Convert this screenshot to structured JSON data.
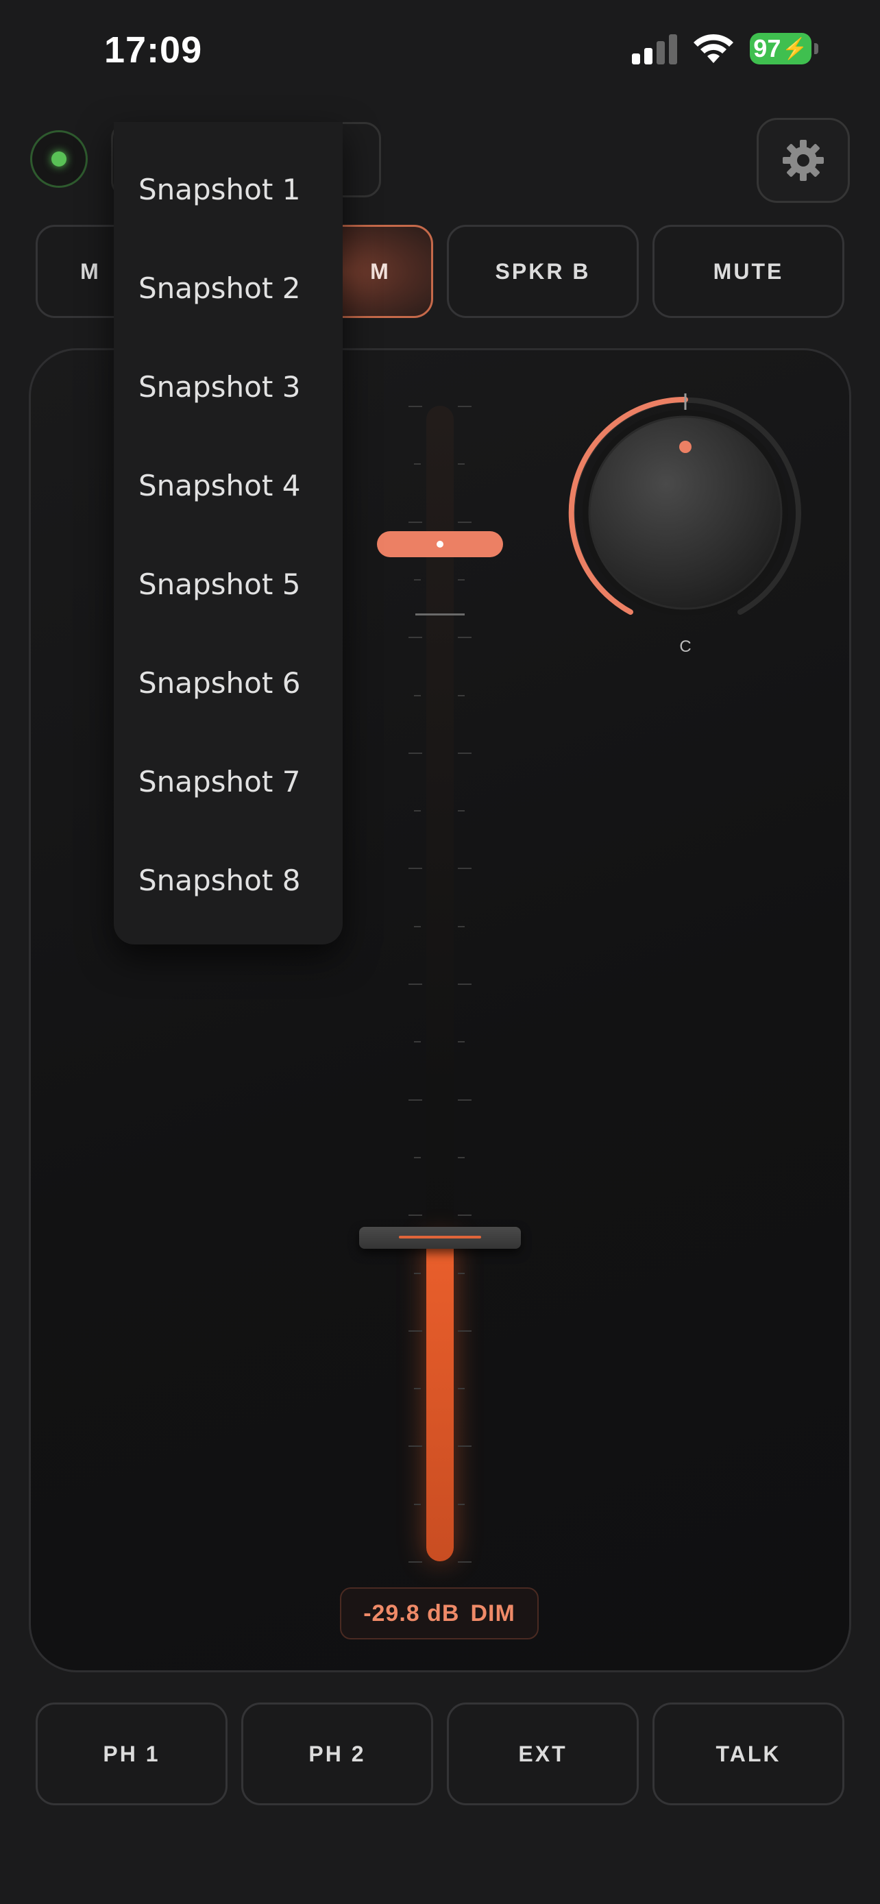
{
  "status_bar": {
    "time": "17:09",
    "battery": "97",
    "icons": [
      "signal-icon",
      "wifi-icon",
      "battery-charging-icon"
    ]
  },
  "top_bar": {
    "status_led_color": "#59c156",
    "settings_icon": "gear-icon"
  },
  "monitor_buttons": [
    {
      "label": "M",
      "active": false
    },
    {
      "label": "M",
      "active": true
    },
    {
      "label": "SPKR B",
      "active": false
    },
    {
      "label": "MUTE",
      "active": false
    }
  ],
  "fader": {
    "level": 0.28,
    "dim_level": 0.88,
    "readout_value": "-29.8 dB",
    "readout_mode": "DIM",
    "accent_color": "#e45f2d"
  },
  "knob": {
    "label": "C",
    "value": 0.5,
    "accent_color": "#ec8064"
  },
  "snapshot_menu": {
    "items": [
      "Snapshot 1",
      "Snapshot 2",
      "Snapshot 3",
      "Snapshot 4",
      "Snapshot 5",
      "Snapshot 6",
      "Snapshot 7",
      "Snapshot 8"
    ]
  },
  "bottom_buttons": [
    {
      "label": "PH 1"
    },
    {
      "label": "PH 2"
    },
    {
      "label": "EXT"
    },
    {
      "label": "TALK"
    }
  ]
}
